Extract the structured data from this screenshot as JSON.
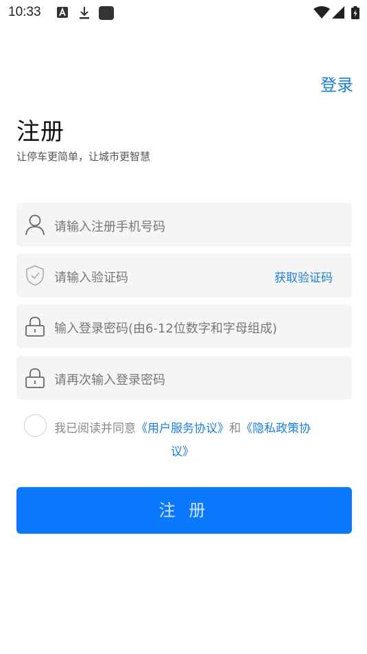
{
  "status": {
    "time": "10:33"
  },
  "header": {
    "login_link": "登录"
  },
  "page": {
    "title": "注册",
    "subtitle": "让停车更简单，让城市更智慧"
  },
  "form": {
    "phone_placeholder": "请输入注册手机号码",
    "code_placeholder": "请输入验证码",
    "get_code_label": "获取验证码",
    "password_placeholder": "输入登录密码(由6-12位数字和字母组成)",
    "confirm_placeholder": "请再次输入登录密码"
  },
  "agreement": {
    "prefix": "我已阅读并同意",
    "user_agreement": "《用户服务协议》",
    "and": "和",
    "privacy_part1": "《隐私政策协",
    "privacy_part2": "议》"
  },
  "register_button": "注 册",
  "colors": {
    "accent": "#1a7fe0",
    "button": "#0a79fb",
    "field_bg": "#f5f5f5"
  }
}
